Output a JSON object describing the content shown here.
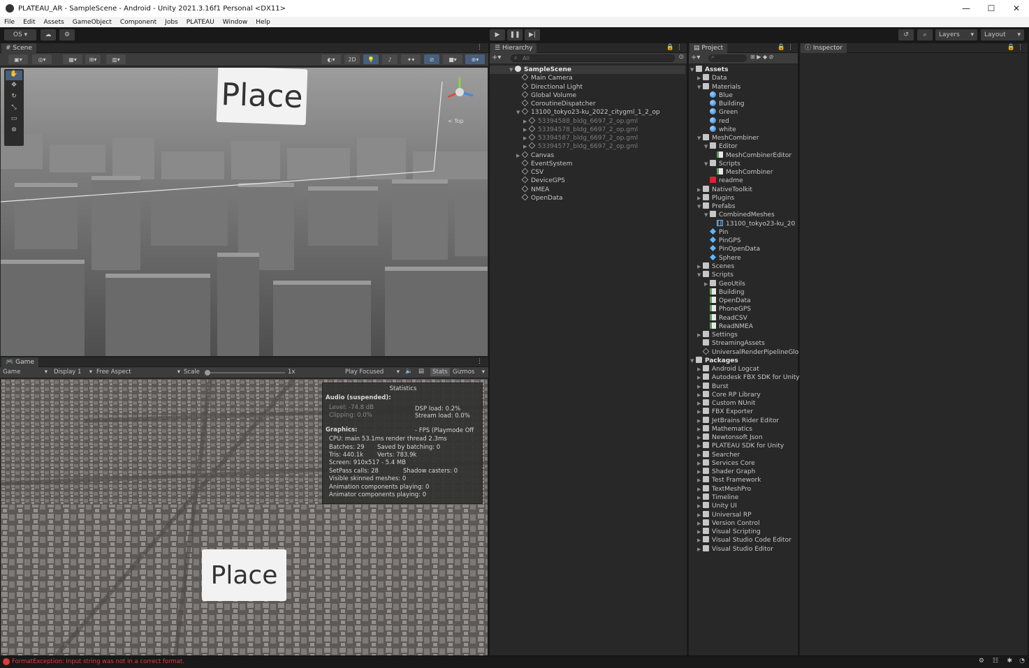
{
  "window": {
    "title": "PLATEAU_AR - SampleScene - Android - Unity 2021.3.16f1 Personal <DX11>",
    "controls": [
      "—",
      "☐",
      "✕"
    ]
  },
  "menu": [
    "File",
    "Edit",
    "Assets",
    "GameObject",
    "Component",
    "Jobs",
    "PLATEAU",
    "Window",
    "Help"
  ],
  "toolbar": {
    "account": "OS",
    "play_icon": "▶",
    "pause_icon": "❚❚",
    "step_icon": "▶|",
    "layers": "Layers",
    "layout": "Layout"
  },
  "scene": {
    "tab": "Scene",
    "btn_2d": "2D",
    "place_label": "Place",
    "gizmo_label": "< Top"
  },
  "game": {
    "tab": "Game",
    "mode": "Game",
    "display": "Display 1",
    "aspect": "Free Aspect",
    "scale_label": "Scale",
    "scale_value": "1x",
    "play_focused": "Play Focused",
    "stats_btn": "Stats",
    "gizmos_btn": "Gizmos",
    "place_label": "Place"
  },
  "stats": {
    "title": "Statistics",
    "audio_header": "Audio (suspended):",
    "level": "Level: -74.8 dB",
    "clipping": "Clipping: 0.0%",
    "dsp": "DSP load: 0.2%",
    "stream": "Stream load: 0.0%",
    "graphics_header": "Graphics:",
    "fps": "- FPS (Playmode Off",
    "cpu": "CPU: main 53.1ms  render thread 2.3ms",
    "batches": "Batches: 29",
    "saved": "Saved by batching: 0",
    "tris": "Tris: 440.1k",
    "verts": "Verts: 783.9k",
    "screen": "Screen: 910x517 - 5.4 MB",
    "setpass": "SetPass calls: 28",
    "shadow": "Shadow casters: 0",
    "skinned": "Visible skinned meshes: 0",
    "anim": "Animation components playing: 0",
    "animator": "Animator components playing: 0"
  },
  "hierarchy": {
    "tab": "Hierarchy",
    "search_placeholder": "All",
    "items": [
      {
        "label": "SampleScene",
        "depth": 0,
        "icon": "scene",
        "bold": true,
        "arrow": "▼"
      },
      {
        "label": "Main Camera",
        "depth": 1,
        "icon": "go"
      },
      {
        "label": "Directional Light",
        "depth": 1,
        "icon": "go"
      },
      {
        "label": "Global Volume",
        "depth": 1,
        "icon": "go"
      },
      {
        "label": "CoroutineDispatcher",
        "depth": 1,
        "icon": "go"
      },
      {
        "label": "13100_tokyo23-ku_2022_citygml_1_2_op",
        "depth": 1,
        "icon": "go",
        "arrow": "▼"
      },
      {
        "label": "53394588_bldg_6697_2_op.gml",
        "depth": 2,
        "icon": "go",
        "dim": true,
        "arrow": "▶"
      },
      {
        "label": "53394578_bldg_6697_2_op.gml",
        "depth": 2,
        "icon": "go",
        "dim": true,
        "arrow": "▶"
      },
      {
        "label": "53394587_bldg_6697_2_op.gml",
        "depth": 2,
        "icon": "go",
        "dim": true,
        "arrow": "▶"
      },
      {
        "label": "53394577_bldg_6697_2_op.gml",
        "depth": 2,
        "icon": "go",
        "dim": true,
        "arrow": "▶"
      },
      {
        "label": "Canvas",
        "depth": 1,
        "icon": "go",
        "arrow": "▶"
      },
      {
        "label": "EventSystem",
        "depth": 1,
        "icon": "go"
      },
      {
        "label": "CSV",
        "depth": 1,
        "icon": "go"
      },
      {
        "label": "DeviceGPS",
        "depth": 1,
        "icon": "go"
      },
      {
        "label": "NMEA",
        "depth": 1,
        "icon": "go"
      },
      {
        "label": "OpenData",
        "depth": 1,
        "icon": "go"
      }
    ]
  },
  "project": {
    "tab": "Project",
    "items": [
      {
        "label": "Assets",
        "depth": 0,
        "icon": "folder",
        "bold": true,
        "arrow": "▼"
      },
      {
        "label": "Data",
        "depth": 1,
        "icon": "folder",
        "arrow": "▶"
      },
      {
        "label": "Materials",
        "depth": 1,
        "icon": "folder",
        "arrow": "▼"
      },
      {
        "label": "Blue",
        "depth": 2,
        "icon": "mat"
      },
      {
        "label": "Building",
        "depth": 2,
        "icon": "mat"
      },
      {
        "label": "Green",
        "depth": 2,
        "icon": "mat"
      },
      {
        "label": "red",
        "depth": 2,
        "icon": "mat"
      },
      {
        "label": "white",
        "depth": 2,
        "icon": "mat"
      },
      {
        "label": "MeshCombiner",
        "depth": 1,
        "icon": "folder",
        "arrow": "▼"
      },
      {
        "label": "Editor",
        "depth": 2,
        "icon": "folder",
        "arrow": "▼"
      },
      {
        "label": "MeshCombinerEditor",
        "depth": 3,
        "icon": "script"
      },
      {
        "label": "Scripts",
        "depth": 2,
        "icon": "folder",
        "arrow": "▼"
      },
      {
        "label": "MeshCombiner",
        "depth": 3,
        "icon": "script"
      },
      {
        "label": "readme",
        "depth": 2,
        "icon": "readme"
      },
      {
        "label": "NativeToolkit",
        "depth": 1,
        "icon": "folder",
        "arrow": "▶"
      },
      {
        "label": "Plugins",
        "depth": 1,
        "icon": "folder",
        "arrow": "▶"
      },
      {
        "label": "Prefabs",
        "depth": 1,
        "icon": "folder",
        "arrow": "▼"
      },
      {
        "label": "CombinedMeshes",
        "depth": 2,
        "icon": "folder",
        "arrow": "▼"
      },
      {
        "label": "13100_tokyo23-ku_20",
        "depth": 3,
        "icon": "mesh"
      },
      {
        "label": "Pin",
        "depth": 2,
        "icon": "prefab"
      },
      {
        "label": "PinGPS",
        "depth": 2,
        "icon": "prefab"
      },
      {
        "label": "PinOpenData",
        "depth": 2,
        "icon": "prefab"
      },
      {
        "label": "Sphere",
        "depth": 2,
        "icon": "prefab"
      },
      {
        "label": "Scenes",
        "depth": 1,
        "icon": "folder",
        "arrow": "▶"
      },
      {
        "label": "Scripts",
        "depth": 1,
        "icon": "folder",
        "arrow": "▼"
      },
      {
        "label": "GeoUtils",
        "depth": 2,
        "icon": "folder",
        "arrow": "▶"
      },
      {
        "label": "Building",
        "depth": 2,
        "icon": "script"
      },
      {
        "label": "OpenData",
        "depth": 2,
        "icon": "script"
      },
      {
        "label": "PhoneGPS",
        "depth": 2,
        "icon": "script"
      },
      {
        "label": "ReadCSV",
        "depth": 2,
        "icon": "script"
      },
      {
        "label": "ReadNMEA",
        "depth": 2,
        "icon": "script"
      },
      {
        "label": "Settings",
        "depth": 1,
        "icon": "folder",
        "arrow": "▶"
      },
      {
        "label": "StreamingAssets",
        "depth": 1,
        "icon": "folder"
      },
      {
        "label": "UniversalRenderPipelineGlo",
        "depth": 1,
        "icon": "go"
      },
      {
        "label": "Packages",
        "depth": 0,
        "icon": "folder",
        "bold": true,
        "arrow": "▼"
      },
      {
        "label": "Android Logcat",
        "depth": 1,
        "icon": "folder",
        "arrow": "▶"
      },
      {
        "label": "Autodesk FBX SDK for Unity",
        "depth": 1,
        "icon": "folder",
        "arrow": "▶"
      },
      {
        "label": "Burst",
        "depth": 1,
        "icon": "folder",
        "arrow": "▶"
      },
      {
        "label": "Core RP Library",
        "depth": 1,
        "icon": "folder",
        "arrow": "▶"
      },
      {
        "label": "Custom NUnit",
        "depth": 1,
        "icon": "folder",
        "arrow": "▶"
      },
      {
        "label": "FBX Exporter",
        "depth": 1,
        "icon": "folder",
        "arrow": "▶"
      },
      {
        "label": "JetBrains Rider Editor",
        "depth": 1,
        "icon": "folder",
        "arrow": "▶"
      },
      {
        "label": "Mathematics",
        "depth": 1,
        "icon": "folder",
        "arrow": "▶"
      },
      {
        "label": "Newtonsoft Json",
        "depth": 1,
        "icon": "folder",
        "arrow": "▶"
      },
      {
        "label": "PLATEAU SDK for Unity",
        "depth": 1,
        "icon": "folder",
        "arrow": "▶"
      },
      {
        "label": "Searcher",
        "depth": 1,
        "icon": "folder",
        "arrow": "▶"
      },
      {
        "label": "Services Core",
        "depth": 1,
        "icon": "folder",
        "arrow": "▶"
      },
      {
        "label": "Shader Graph",
        "depth": 1,
        "icon": "folder",
        "arrow": "▶"
      },
      {
        "label": "Test Framework",
        "depth": 1,
        "icon": "folder",
        "arrow": "▶"
      },
      {
        "label": "TextMeshPro",
        "depth": 1,
        "icon": "folder",
        "arrow": "▶"
      },
      {
        "label": "Timeline",
        "depth": 1,
        "icon": "folder",
        "arrow": "▶"
      },
      {
        "label": "Unity UI",
        "depth": 1,
        "icon": "folder",
        "arrow": "▶"
      },
      {
        "label": "Universal RP",
        "depth": 1,
        "icon": "folder",
        "arrow": "▶"
      },
      {
        "label": "Version Control",
        "depth": 1,
        "icon": "folder",
        "arrow": "▶"
      },
      {
        "label": "Visual Scripting",
        "depth": 1,
        "icon": "folder",
        "arrow": "▶"
      },
      {
        "label": "Visual Studio Code Editor",
        "depth": 1,
        "icon": "folder",
        "arrow": "▶"
      },
      {
        "label": "Visual Studio Editor",
        "depth": 1,
        "icon": "folder",
        "arrow": "▶"
      }
    ]
  },
  "inspector": {
    "tab": "Inspector"
  },
  "status": {
    "error": "FormatException: Input string was not in a correct format.",
    "error_color": "#e03a3a"
  }
}
